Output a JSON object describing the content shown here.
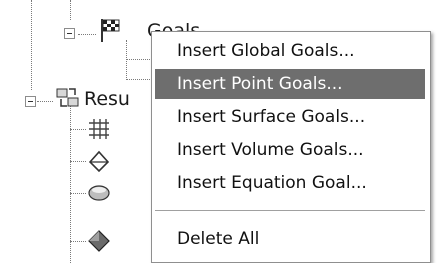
{
  "tree": {
    "goals_label": "Goals",
    "results_label": "Resu"
  },
  "context_menu": {
    "items": [
      {
        "label": "Insert Global Goals..."
      },
      {
        "label": "Insert Point Goals..."
      },
      {
        "label": "Insert Surface Goals..."
      },
      {
        "label": "Insert Volume Goals..."
      },
      {
        "label": "Insert Equation Goal..."
      }
    ],
    "delete_all_label": "Delete All",
    "highlighted_index": 1
  },
  "colors": {
    "highlight": "#6e6e6e",
    "menu_border": "#8f8f8f"
  }
}
